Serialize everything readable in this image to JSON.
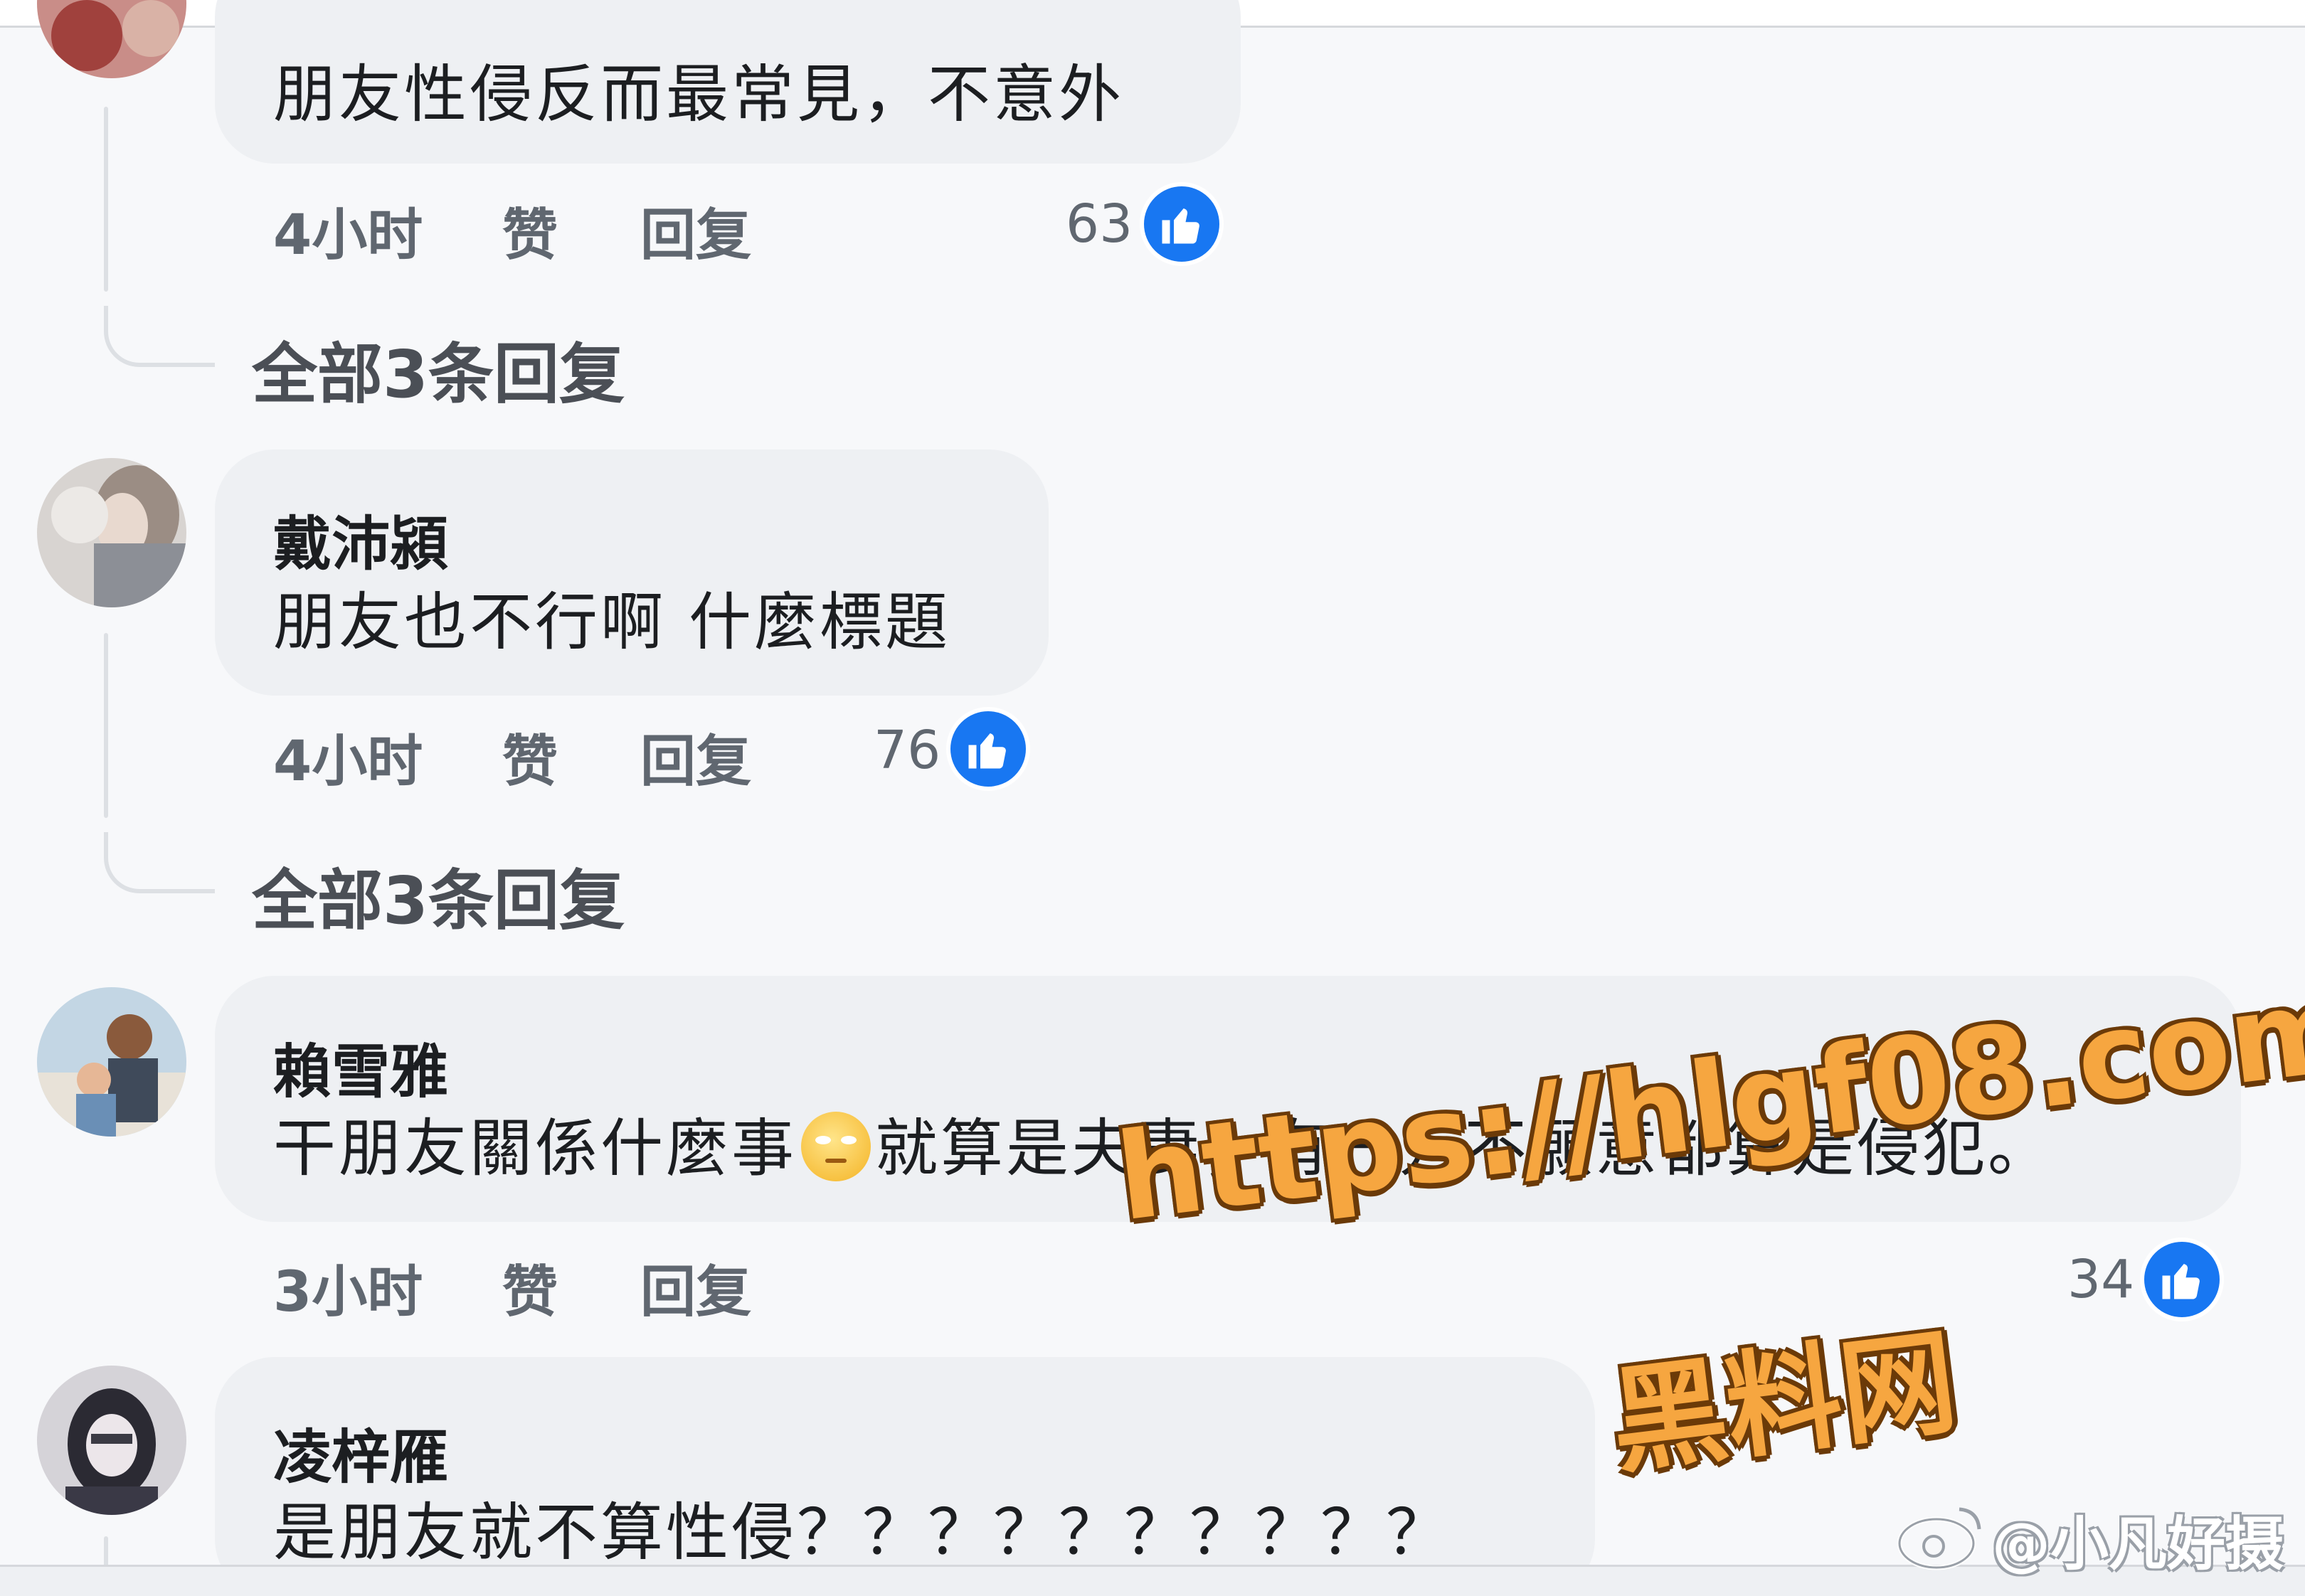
{
  "colors": {
    "accent": "#1877f2",
    "bubble": "#eef0f3",
    "background": "#f7f8fa",
    "meta_text": "#606770",
    "watermark": "#f6a640"
  },
  "comments": [
    {
      "author": "",
      "text": "朋友性侵反而最常見，不意外",
      "time": "4小时",
      "like_label": "赞",
      "reply_label": "回复",
      "like_count": "63",
      "view_replies": "全部3条回复",
      "like_icon": "thumbs-up-icon"
    },
    {
      "author": "戴沛潁",
      "text": "朋友也不行啊 什麼標題",
      "time": "4小时",
      "like_label": "赞",
      "reply_label": "回复",
      "like_count": "76",
      "view_replies": "全部3条回复",
      "like_icon": "thumbs-up-icon"
    },
    {
      "author": "賴雪雅",
      "text_before_emoji": "干朋友關係什麼事",
      "emoji": "rolling-eyes-emoji",
      "text_after_emoji": "就算是夫妻，有一方不願意都算是侵犯。",
      "time": "3小时",
      "like_label": "赞",
      "reply_label": "回复",
      "like_count": "34",
      "like_icon": "thumbs-up-icon"
    },
    {
      "author": "凌梓雁",
      "text": "是朋友就不算性侵？？？？？？？？？？"
    }
  ],
  "watermark": {
    "url": "https://hlgf08.com",
    "site_name": "黑料网",
    "weibo_handle": "@小凡好摄",
    "weibo_icon": "weibo-icon"
  }
}
